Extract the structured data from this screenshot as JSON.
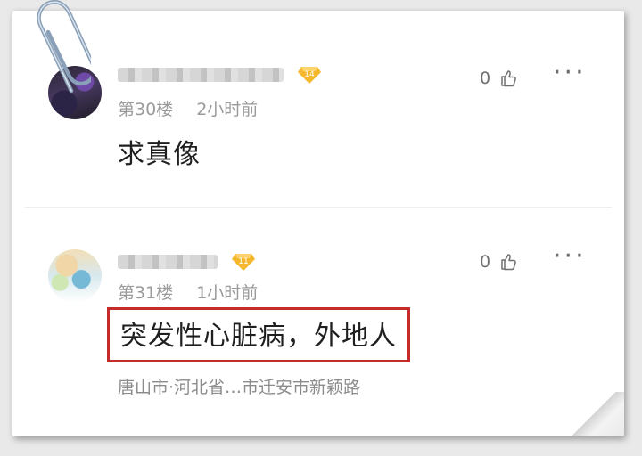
{
  "colors": {
    "highlight_border": "#c42b2b",
    "badge": "#f5b72c",
    "meta_text": "#9a9a9a",
    "content_text": "#1f1f1f"
  },
  "comments": [
    {
      "level": "14",
      "floor": "第30楼",
      "time": "2小时前",
      "text": "求真像",
      "likes": "0",
      "more": "···",
      "highlighted": false
    },
    {
      "level": "11",
      "floor": "第31楼",
      "time": "1小时前",
      "text": "突发性心脏病，外地人",
      "location": "唐山市·河北省…市迁安市新颖路",
      "likes": "0",
      "more": "···",
      "highlighted": true
    }
  ],
  "icons": {
    "like": "thumbs-up-icon",
    "more": "more-dots-icon",
    "level": "diamond-badge-icon",
    "clip": "paperclip-icon"
  }
}
